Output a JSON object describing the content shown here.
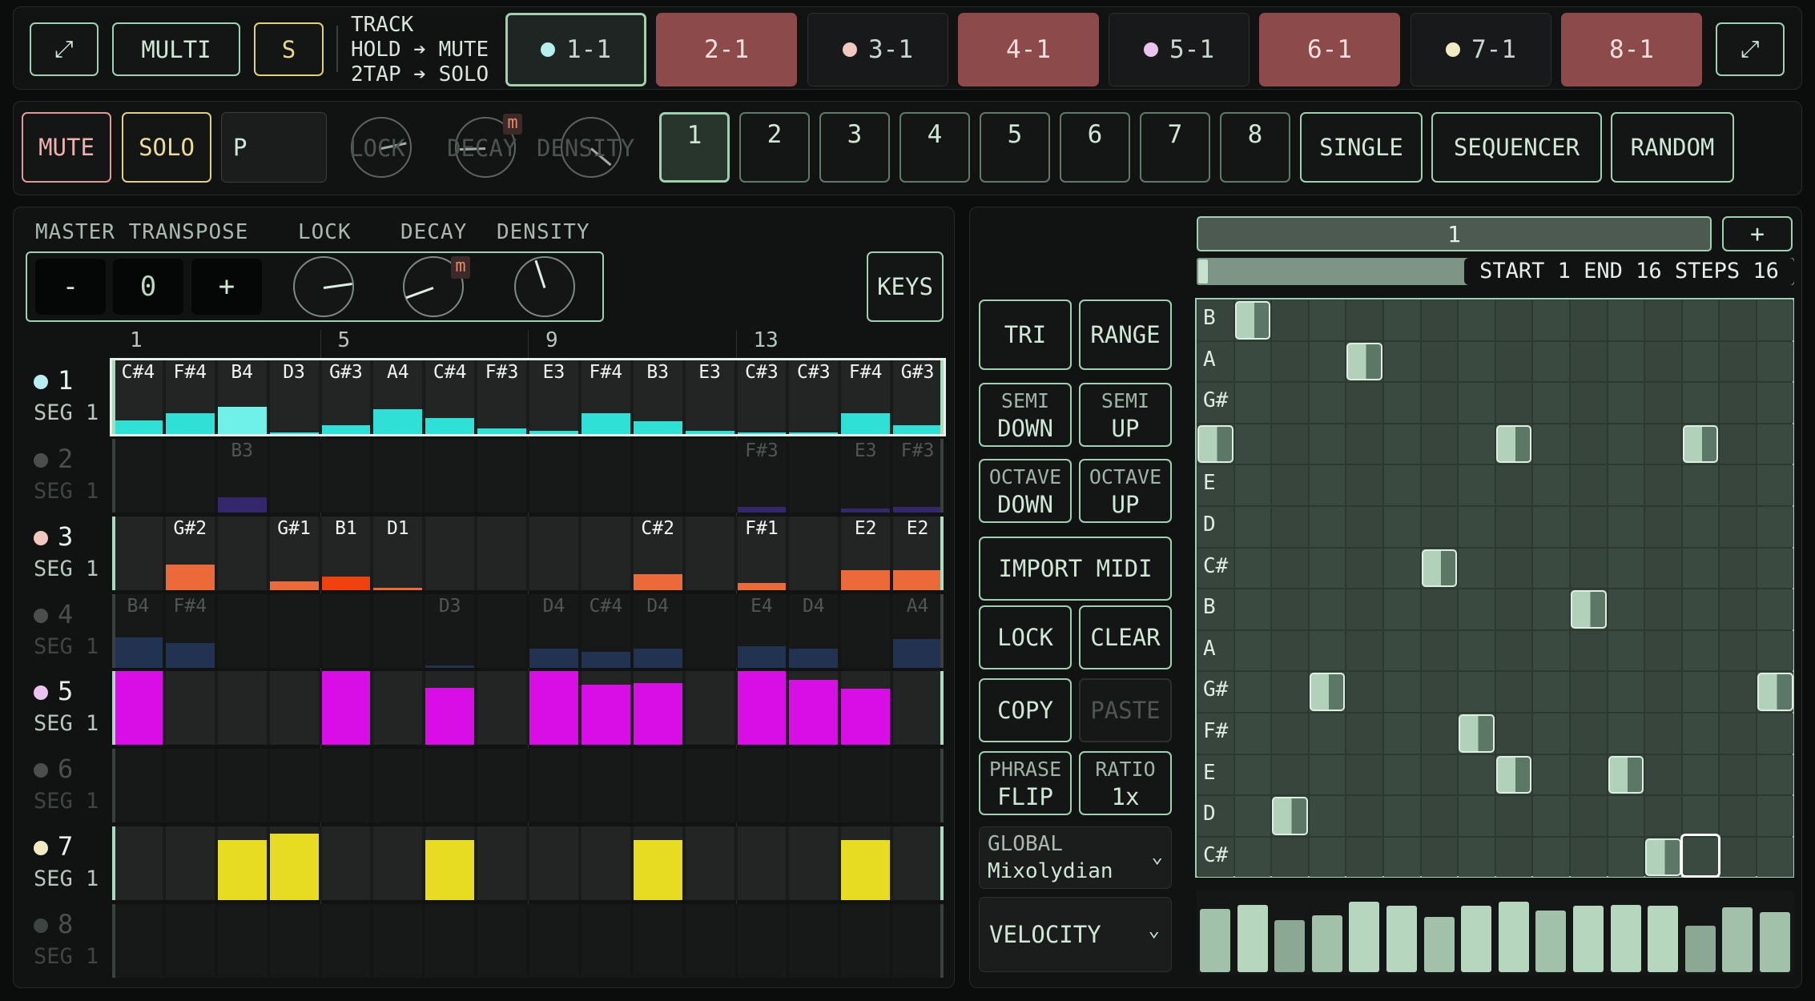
{
  "top": {
    "expand_left": "⤢",
    "multi": "MULTI",
    "s": "S",
    "track_title": "TRACK",
    "hint1": "HOLD ➔ MUTE",
    "hint2": "2TAP ➔ SOLO",
    "tracks": [
      {
        "label": "1-1",
        "dot": "#b7eef0",
        "style": "selected"
      },
      {
        "label": "2-1",
        "dot": "",
        "style": "red"
      },
      {
        "label": "3-1",
        "dot": "#f0c8bd",
        "style": "normal"
      },
      {
        "label": "4-1",
        "dot": "",
        "style": "red"
      },
      {
        "label": "5-1",
        "dot": "#eac3f1",
        "style": "normal"
      },
      {
        "label": "6-1",
        "dot": "",
        "style": "red"
      },
      {
        "label": "7-1",
        "dot": "#f1ebc3",
        "style": "normal"
      },
      {
        "label": "8-1",
        "dot": "",
        "style": "red"
      }
    ],
    "expand_right": "⤢"
  },
  "second": {
    "mute": "MUTE",
    "solo": "SOLO",
    "p_field": "P",
    "ghost_lock": "LOCK",
    "ghost_decay": "DECAY",
    "ghost_density": "DENSITY",
    "ghost_m": "m",
    "numbers": [
      "1",
      "2",
      "3",
      "4",
      "5",
      "6",
      "7",
      "8"
    ],
    "single": "SINGLE",
    "sequencer": "SEQUENCER",
    "random": "RANDOM"
  },
  "left": {
    "master_transpose": "MASTER TRANSPOSE",
    "lock": "LOCK",
    "decay": "DECAY",
    "density": "DENSITY",
    "minus": "-",
    "value": "0",
    "plus": "+",
    "m": "m",
    "keys": "KEYS",
    "ruler": [
      "1",
      "5",
      "9",
      "13"
    ],
    "seg": "SEG 1",
    "rows": [
      {
        "num": "1",
        "dot": "#b7eef0",
        "dim": false,
        "color": "#2ee0d6",
        "notes": [
          "C#4",
          "F#4",
          "B4",
          "D3",
          "G#3",
          "A4",
          "C#4",
          "F#3",
          "E3",
          "F#4",
          "B3",
          "E3",
          "C#3",
          "C#3",
          "F#4",
          "G#3"
        ],
        "vals": [
          0.28,
          0.42,
          0.55,
          0.04,
          0.17,
          0.5,
          0.32,
          0.12,
          0.06,
          0.42,
          0.25,
          0.06,
          0.03,
          0.03,
          0.42,
          0.17
        ]
      },
      {
        "num": "2",
        "dot": "#4a4f4d",
        "dim": true,
        "color": "#3a2a7a",
        "notes": [
          "",
          "",
          "B3",
          "",
          "",
          "",
          "",
          "",
          "",
          "",
          "",
          "",
          "F#3",
          "",
          "E3",
          "F#3"
        ],
        "vals": [
          0,
          0,
          0.3,
          0,
          0,
          0,
          0,
          0,
          0,
          0,
          0,
          0,
          0.12,
          0,
          0.08,
          0.12
        ]
      },
      {
        "num": "3",
        "dot": "#f0c8bd",
        "dim": false,
        "color": "#ec6a3a",
        "notes": [
          "",
          "G#2",
          "",
          "G#1",
          "B1",
          "D1",
          "",
          "",
          "",
          "",
          "C#2",
          "",
          "F#1",
          "",
          "E2",
          "E2"
        ],
        "vals": [
          0,
          0.52,
          0,
          0.18,
          0.28,
          0.05,
          0,
          0,
          0,
          0,
          0.32,
          0,
          0.14,
          0,
          0.4,
          0.4
        ]
      },
      {
        "num": "4",
        "dot": "#4a4f4d",
        "dim": true,
        "color": "#23385a",
        "notes": [
          "B4",
          "F#4",
          "",
          "",
          "",
          "",
          "D3",
          "",
          "D4",
          "C#4",
          "D4",
          "",
          "E4",
          "D4",
          "",
          "A4"
        ],
        "vals": [
          0.62,
          0.5,
          0,
          0,
          0,
          0,
          0.05,
          0,
          0.38,
          0.33,
          0.38,
          0,
          0.43,
          0.38,
          0,
          0.58
        ]
      },
      {
        "num": "5",
        "dot": "#eac3f1",
        "dim": false,
        "color": "#d90ee6",
        "notes": [],
        "vals": [
          1,
          0,
          0,
          0,
          1,
          0,
          0.77,
          0,
          1,
          0.82,
          0.84,
          0,
          1,
          0.88,
          0.76,
          0
        ]
      },
      {
        "num": "6",
        "dot": "#4a4f4d",
        "dim": true,
        "color": "#333",
        "notes": [],
        "vals": [
          0,
          0,
          0,
          0,
          0,
          0,
          0,
          0,
          0,
          0,
          0,
          0,
          0,
          0,
          0,
          0
        ]
      },
      {
        "num": "7",
        "dot": "#f1ebc3",
        "dim": false,
        "color": "#e8dc22",
        "notes": [],
        "vals": [
          0,
          0,
          0.82,
          0.9,
          0,
          0,
          0.82,
          0,
          0,
          0,
          0.82,
          0,
          0,
          0,
          0.82,
          0
        ]
      },
      {
        "num": "8",
        "dot": "#3d4540",
        "dim": true,
        "color": "#34502a",
        "notes": [],
        "vals": [
          0,
          0,
          0,
          0,
          0,
          0,
          0,
          0,
          0,
          0,
          0,
          0,
          0,
          0,
          0,
          0
        ]
      }
    ]
  },
  "mid": {
    "tri": "TRI",
    "range": "RANGE",
    "semi_down_1": "SEMI",
    "semi_down_2": "DOWN",
    "semi_up_1": "SEMI",
    "semi_up_2": "UP",
    "oct_down_1": "OCTAVE",
    "oct_down_2": "DOWN",
    "oct_up_1": "OCTAVE",
    "oct_up_2": "UP",
    "import_midi": "IMPORT MIDI",
    "lock": "LOCK",
    "clear": "CLEAR",
    "copy": "COPY",
    "paste": "PASTE",
    "phrase_1": "PHRASE",
    "phrase_2": "FLIP",
    "ratio_1": "RATIO",
    "ratio_2": "1x",
    "global_1": "GLOBAL",
    "global_2": "Mixolydian",
    "velocity": "VELOCITY"
  },
  "right": {
    "pattern": "1",
    "add": "+",
    "range_info": "START 1 END 16 STEPS 16",
    "notes": [
      "B",
      "A",
      "G#",
      "F#",
      "E",
      "D",
      "C#",
      "B",
      "A",
      "G#",
      "F#",
      "E",
      "D",
      "C#"
    ],
    "placed": [
      [
        1,
        0
      ],
      [
        4,
        1
      ],
      [
        0,
        3
      ],
      [
        8,
        3
      ],
      [
        13,
        3
      ],
      [
        6,
        6
      ],
      [
        10,
        7
      ],
      [
        3,
        9
      ],
      [
        15,
        9
      ],
      [
        7,
        10
      ],
      [
        8,
        11
      ],
      [
        11,
        11
      ],
      [
        2,
        12
      ],
      [
        12,
        13
      ]
    ],
    "velocity": [
      0.82,
      0.88,
      0.68,
      0.74,
      0.92,
      0.86,
      0.72,
      0.86,
      0.92,
      0.8,
      0.86,
      0.88,
      0.86,
      0.6,
      0.84,
      0.78
    ]
  }
}
